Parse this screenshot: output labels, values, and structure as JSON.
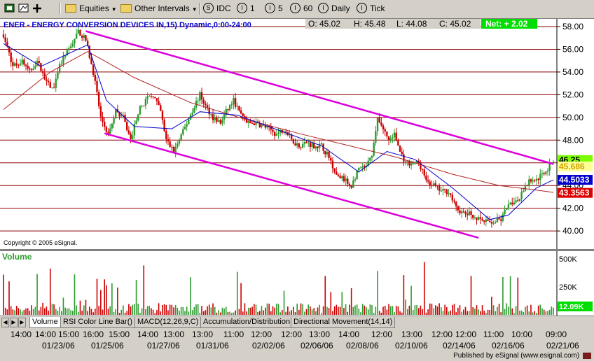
{
  "toolbar": {
    "items": [
      {
        "label": "Equities",
        "type": "folder-dropdown"
      },
      {
        "label": "Other Intervals",
        "type": "folder-dropdown"
      },
      {
        "label": "IDC",
        "icon": "S"
      },
      {
        "label": "1",
        "icon": "I"
      },
      {
        "label": "5",
        "icon": "I"
      },
      {
        "label": "60",
        "icon": "I"
      },
      {
        "label": "Daily",
        "icon": "I"
      },
      {
        "label": "Tick",
        "icon": "I"
      }
    ]
  },
  "header": {
    "title": "ENER - ENERGY CONVERSION DEVICES IN,15) Dynamic,0:00-24:00",
    "open": "O: 45.02",
    "high": "H: 45.48",
    "low": "L: 44.08",
    "close": "C: 45.02",
    "net": "Net: + 2.02"
  },
  "copyright": "Copyright © 2005 eSignal.",
  "volume_label": "Volume",
  "tabs": [
    "Volume",
    "RSI Color Line Bar()",
    "MACD(12,26,9,C)",
    "Accumulation/Distribution",
    "Directional Movement(14,14)"
  ],
  "x_time_labels": [
    "14:00",
    "14:00",
    "15:00",
    "16:00",
    "15:00",
    "14:00",
    "13:00",
    "13:00",
    "11:00",
    "12:00",
    "12:00",
    "13:00",
    "14:00",
    "12:00",
    "13:00",
    "12:00",
    "12:00",
    "11:00",
    "10:00",
    "09:00"
  ],
  "x_date_labels": [
    "01/23/06",
    "01/25/06",
    "01/27/06",
    "01/31/06",
    "02/02/06",
    "02/06/06",
    "02/08/06",
    "02/10/06",
    "02/14/06",
    "02/16/06",
    "02/21/06"
  ],
  "footer": "Published by eSignal (www.esignal.com)",
  "colors": {
    "background": "#ffffff",
    "grid": "#8b0000",
    "up_candle": "#2e9a2e",
    "down_candle": "#cc0000",
    "channel": "#dd00dd",
    "ma_fast": "#0000cc",
    "ma_slow": "#b22222",
    "last_price": "#7cfc00",
    "ma_fast_box": "#0000cc",
    "ma_slow_box": "#dd0000"
  },
  "chart_data": {
    "type": "candlestick",
    "y_ticks": [
      40.0,
      42.0,
      44.0,
      46.0,
      48.0,
      50.0,
      52.0,
      54.0,
      56.0,
      58.0
    ],
    "ylim": [
      39.2,
      58.6
    ],
    "price_markers": [
      "46.25",
      "45.686",
      "44.5033",
      "43.3563"
    ],
    "volume_ticks": [
      "500K",
      "250K"
    ],
    "volume_last": "12.09K",
    "volume_max": 520000,
    "anchors": [
      [
        0,
        57.3
      ],
      [
        5,
        54.5
      ],
      [
        10,
        55.0
      ],
      [
        14,
        54.0
      ],
      [
        18,
        55.0
      ],
      [
        23,
        53.0
      ],
      [
        27,
        52.5
      ],
      [
        30,
        54.5
      ],
      [
        35,
        56.0
      ],
      [
        40,
        57.6
      ],
      [
        44,
        56.8
      ],
      [
        48,
        54.0
      ],
      [
        52,
        50.0
      ],
      [
        56,
        48.5
      ],
      [
        60,
        50.5
      ],
      [
        64,
        50.0
      ],
      [
        68,
        48.0
      ],
      [
        72,
        50.5
      ],
      [
        76,
        51.5
      ],
      [
        80,
        52.0
      ],
      [
        84,
        50.5
      ],
      [
        87,
        48.0
      ],
      [
        91,
        47.0
      ],
      [
        94,
        48.0
      ],
      [
        98,
        49.5
      ],
      [
        102,
        51.0
      ],
      [
        105,
        52.0
      ],
      [
        108,
        51.0
      ],
      [
        112,
        50.0
      ],
      [
        116,
        49.5
      ],
      [
        119,
        50.5
      ],
      [
        123,
        51.5
      ],
      [
        126,
        50.5
      ],
      [
        130,
        49.5
      ],
      [
        134,
        49.5
      ],
      [
        138,
        49.3
      ],
      [
        142,
        49.0
      ],
      [
        146,
        48.5
      ],
      [
        150,
        49.0
      ],
      [
        154,
        48.0
      ],
      [
        158,
        47.5
      ],
      [
        162,
        47.8
      ],
      [
        166,
        47.5
      ],
      [
        170,
        47.5
      ],
      [
        174,
        46.5
      ],
      [
        178,
        45.0
      ],
      [
        182,
        44.5
      ],
      [
        186,
        44.0
      ],
      [
        190,
        45.5
      ],
      [
        193,
        45.5
      ],
      [
        197,
        46.5
      ],
      [
        200,
        50.0
      ],
      [
        203,
        49.0
      ],
      [
        206,
        48.0
      ],
      [
        209,
        48.5
      ],
      [
        212,
        47.0
      ],
      [
        215,
        46.0
      ],
      [
        219,
        46.0
      ],
      [
        222,
        46.0
      ],
      [
        226,
        44.5
      ],
      [
        230,
        44.0
      ],
      [
        234,
        43.5
      ],
      [
        238,
        43.5
      ],
      [
        242,
        42.0
      ],
      [
        246,
        41.5
      ],
      [
        250,
        41.5
      ],
      [
        254,
        41.0
      ],
      [
        258,
        40.8
      ],
      [
        262,
        40.8
      ],
      [
        266,
        41.0
      ],
      [
        269,
        42.0
      ],
      [
        272,
        42.5
      ],
      [
        276,
        43.0
      ],
      [
        279,
        44.0
      ],
      [
        282,
        44.5
      ],
      [
        285,
        44.5
      ],
      [
        288,
        45.0
      ],
      [
        291,
        45.5
      ],
      [
        294,
        46.25
      ]
    ],
    "ma_fast": [
      [
        0,
        56.5
      ],
      [
        20,
        54.5
      ],
      [
        45,
        56.4
      ],
      [
        55,
        51.5
      ],
      [
        70,
        49.2
      ],
      [
        90,
        49.0
      ],
      [
        105,
        50.5
      ],
      [
        125,
        50.2
      ],
      [
        145,
        49.0
      ],
      [
        170,
        47.5
      ],
      [
        190,
        45.2
      ],
      [
        205,
        47.0
      ],
      [
        220,
        46.3
      ],
      [
        240,
        43.8
      ],
      [
        260,
        41.0
      ],
      [
        270,
        41.4
      ],
      [
        285,
        43.8
      ],
      [
        294,
        44.5
      ]
    ],
    "ma_slow": [
      [
        0,
        50.7
      ],
      [
        25,
        54.0
      ],
      [
        45,
        55.8
      ],
      [
        70,
        53.5
      ],
      [
        100,
        51.3
      ],
      [
        130,
        49.8
      ],
      [
        160,
        48.5
      ],
      [
        185,
        47.5
      ],
      [
        210,
        46.5
      ],
      [
        240,
        45.0
      ],
      [
        265,
        44.0
      ],
      [
        285,
        43.6
      ],
      [
        294,
        43.4
      ]
    ],
    "channel_upper": [
      [
        44,
        57.6
      ],
      [
        294,
        45.9
      ]
    ],
    "channel_lower": [
      [
        54,
        48.6
      ],
      [
        254,
        39.4
      ]
    ]
  }
}
